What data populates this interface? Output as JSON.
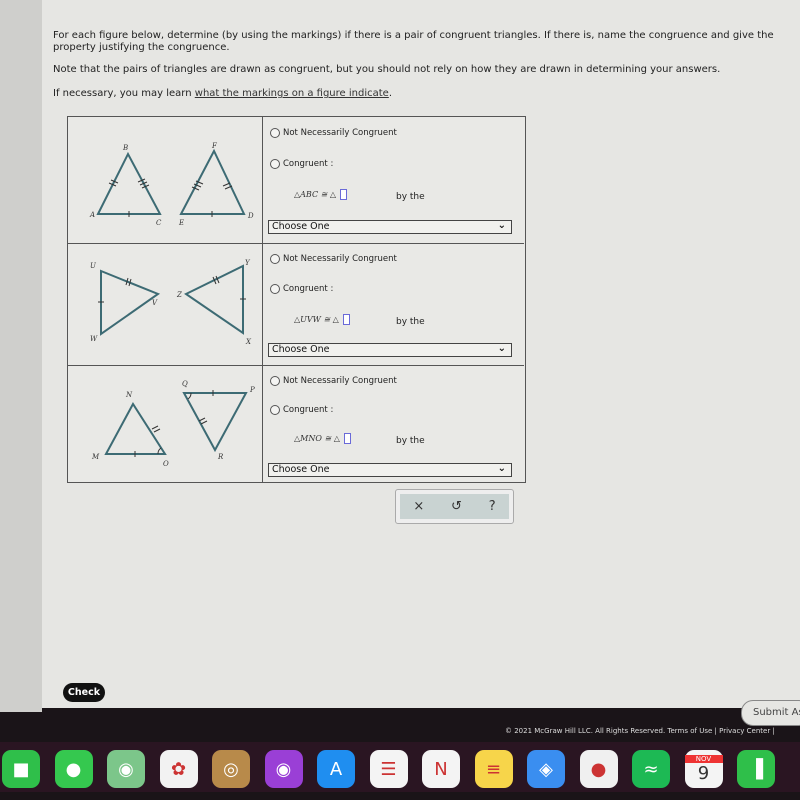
{
  "instructions": {
    "line1": "For each figure below, determine (by using the markings) if there is a pair of congruent triangles. If there is, name the congruence and give the property justifying the congruence.",
    "line2": "Note that the pairs of triangles are drawn as congruent, but you should not rely on how they are drawn in determining your answers.",
    "line3_prefix": "If necessary, you may learn ",
    "line3_link": "what the markings on a figure indicate",
    "line3_suffix": "."
  },
  "problems": [
    {
      "labels": [
        "A",
        "B",
        "C",
        "D",
        "E",
        "F"
      ],
      "not_congruent": "Not Necessarily Congruent",
      "congruent": "Congruent :",
      "statement": "△ABC ≅ △",
      "by_the": "by the",
      "select": "Choose One"
    },
    {
      "labels": [
        "U",
        "V",
        "W",
        "X",
        "Y",
        "Z"
      ],
      "not_congruent": "Not Necessarily Congruent",
      "congruent": "Congruent :",
      "statement": "△UVW ≅ △",
      "by_the": "by the",
      "select": "Choose One"
    },
    {
      "labels": [
        "M",
        "N",
        "O",
        "P",
        "Q",
        "R"
      ],
      "not_congruent": "Not Necessarily Congruent",
      "congruent": "Congruent :",
      "statement": "△MNO ≅ △",
      "by_the": "by the",
      "select": "Choose One"
    }
  ],
  "tools": {
    "clear": "×",
    "undo": "↺",
    "help": "?"
  },
  "check_label": "Check",
  "submit_label": "Submit As",
  "footer": "© 2021 McGraw Hill LLC. All Rights Reserved.   Terms of Use  |  Privacy Center  |",
  "dock": [
    {
      "name": "facetime",
      "color": "#2fbf4a",
      "glyph": "■"
    },
    {
      "name": "messages",
      "color": "#35c84f",
      "glyph": "●"
    },
    {
      "name": "maps",
      "color": "#7cc68a",
      "glyph": "◉"
    },
    {
      "name": "photos",
      "color": "#f2f2f2",
      "glyph": "✿"
    },
    {
      "name": "contacts",
      "color": "#b88a4a",
      "glyph": "◎"
    },
    {
      "name": "podcasts",
      "color": "#9a3fd6",
      "glyph": "◉"
    },
    {
      "name": "app-store",
      "color": "#1f8ef0",
      "glyph": "A"
    },
    {
      "name": "reminders",
      "color": "#f4f4f4",
      "glyph": "☰"
    },
    {
      "name": "news",
      "color": "#f4f4f4",
      "glyph": "N"
    },
    {
      "name": "notes",
      "color": "#f7d54a",
      "glyph": "≡"
    },
    {
      "name": "safari",
      "color": "#3a8ef0",
      "glyph": "◈"
    },
    {
      "name": "chrome",
      "color": "#f0f0f0",
      "glyph": "●"
    },
    {
      "name": "spotify",
      "color": "#1db954",
      "glyph": "≈"
    },
    {
      "name": "calendar",
      "color": "#f4f4f4",
      "glyph": "9",
      "month": "NOV"
    },
    {
      "name": "numbers",
      "color": "#2fbf4a",
      "glyph": "▐"
    }
  ]
}
